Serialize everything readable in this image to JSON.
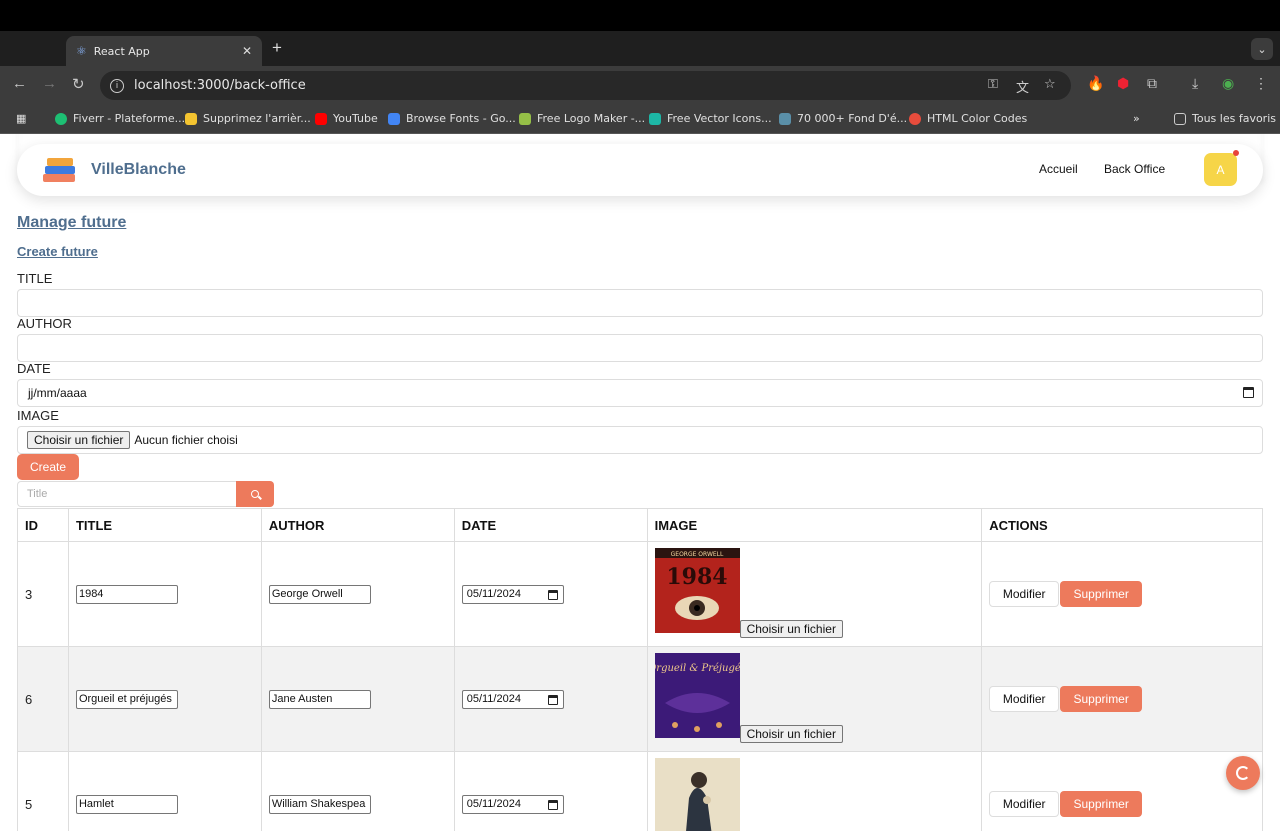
{
  "browser": {
    "tab_title": "React App",
    "url": "localhost:3000/back-office",
    "bookmarks": [
      {
        "label": "Fiverr - Plateforme...",
        "color": "#1dbf73"
      },
      {
        "label": "Supprimez l'arrièr...",
        "color": "#f4c430"
      },
      {
        "label": "YouTube",
        "color": "#ff0000"
      },
      {
        "label": "Browse Fonts - Go...",
        "color": "#4285f4"
      },
      {
        "label": "Free Logo Maker -...",
        "color": "#95bf47"
      },
      {
        "label": "Free Vector Icons...",
        "color": "#1db7a6"
      },
      {
        "label": "70 000+ Fond D'é...",
        "color": "#5a8fa8"
      },
      {
        "label": "HTML Color Codes",
        "color": "#e74c3c"
      }
    ],
    "all_bookmarks": "Tous les favoris"
  },
  "navbar": {
    "brand": "VilleBlanche",
    "links": [
      "Accueil",
      "Back Office"
    ],
    "avatar_letter": "A"
  },
  "page": {
    "heading": "Manage future",
    "subheading": "Create future",
    "form": {
      "title_label": "TITLE",
      "author_label": "AUTHOR",
      "date_label": "DATE",
      "date_placeholder": "jj/mm/aaaa",
      "image_label": "IMAGE",
      "file_button": "Choisir un fichier",
      "file_status": "Aucun fichier choisi",
      "create_button": "Create"
    },
    "search_placeholder": "Title"
  },
  "table": {
    "headers": [
      "ID",
      "TITLE",
      "AUTHOR",
      "DATE",
      "IMAGE",
      "ACTIONS"
    ],
    "rows": [
      {
        "id": "3",
        "title": "1984",
        "author": "George Orwell",
        "date": "05/11/2024",
        "file_button": "Choisir un fichier",
        "modify": "Modifier",
        "delete": "Supprimer",
        "cover_text": "1984",
        "cover_author": "GEORGE ORWELL"
      },
      {
        "id": "6",
        "title": "Orgueil et préjugés",
        "author": "Jane Austen",
        "date": "05/11/2024",
        "file_button": "Choisir un fichier",
        "modify": "Modifier",
        "delete": "Supprimer",
        "cover_text": "Orgueil & Préjugés"
      },
      {
        "id": "5",
        "title": "Hamlet",
        "author": "William Shakespea",
        "date": "05/11/2024",
        "modify": "Modifier",
        "delete": "Supprimer"
      }
    ]
  },
  "colors": {
    "accent": "#ed7a5c",
    "brand_text": "#4f6e8e",
    "avatar": "#f6d548"
  }
}
